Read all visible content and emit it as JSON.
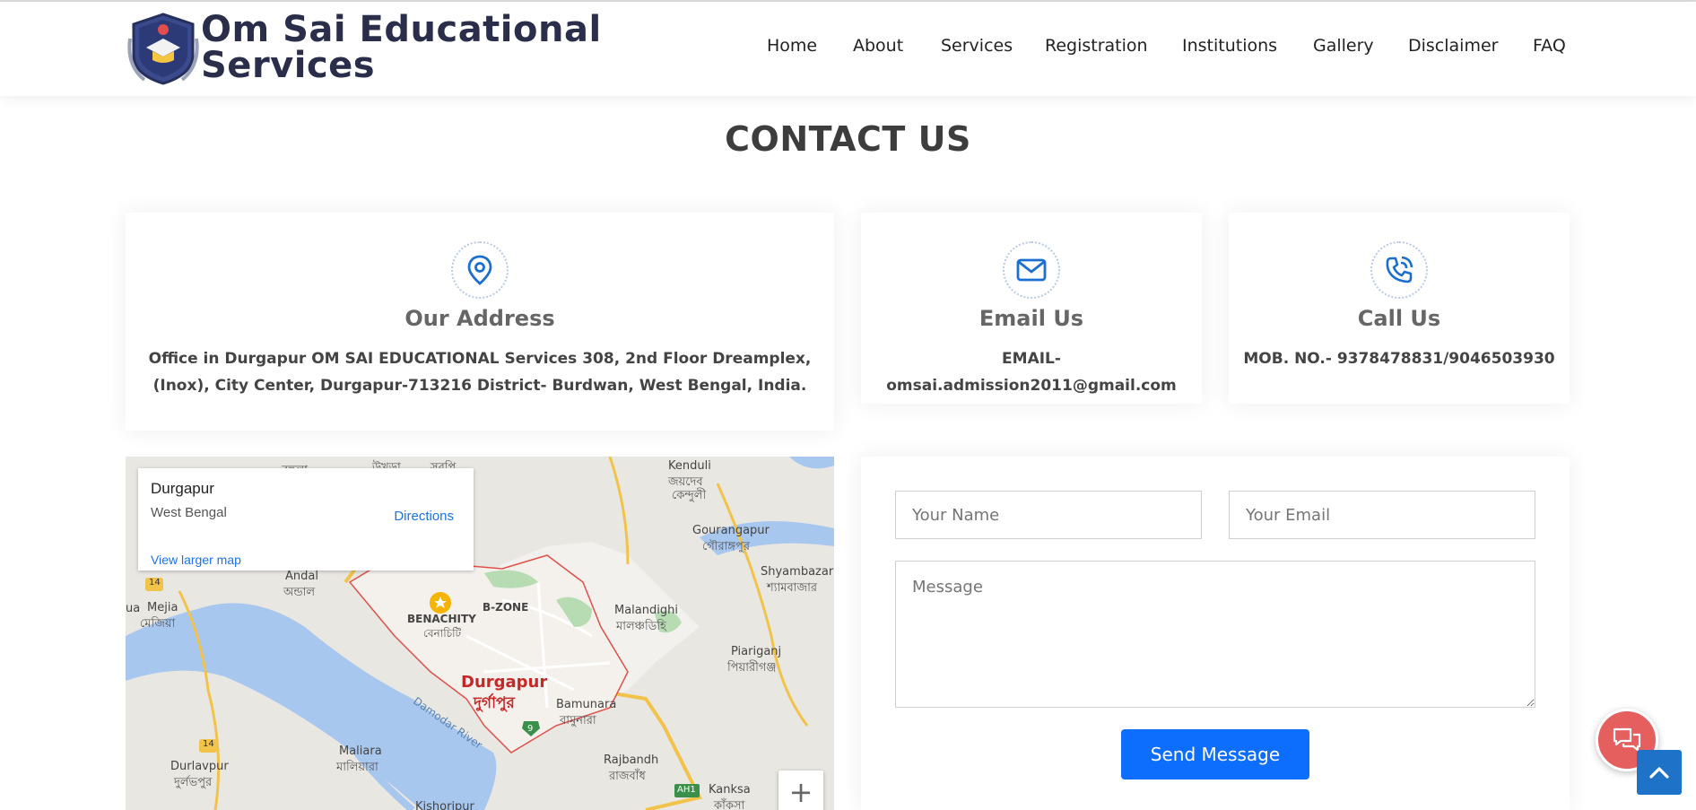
{
  "header": {
    "brand_line1": "Om Sai Educational",
    "brand_line2": "Services",
    "nav": [
      "Home",
      "About",
      "Services",
      "Registration",
      "Institutions",
      "Gallery",
      "Disclaimer",
      "FAQ"
    ]
  },
  "page": {
    "title": "CONTACT US"
  },
  "cards": {
    "address": {
      "icon": "map-pin-icon",
      "title": "Our Address",
      "text": "Office in Durgapur OM SAI EDUCATIONAL Services 308, 2nd Floor Dreamplex, (Inox), City Center, Durgapur-713216 District- Burdwan, West Bengal, India."
    },
    "email": {
      "icon": "envelope-icon",
      "title": "Email Us",
      "text": "EMAIL- omsai.admission2011@gmail.com"
    },
    "call": {
      "icon": "phone-call-icon",
      "title": "Call Us",
      "text": "MOB. NO.- 9378478831/9046503930"
    }
  },
  "map": {
    "popup_title": "Durgapur",
    "popup_subtitle": "West Bengal",
    "directions_label": "Directions",
    "larger_map_label": "View larger map",
    "zoom_in_label": "+",
    "labels": {
      "durgapur": "Durgapur",
      "durgapur_bn": "দুর্গাপুর",
      "benachity": "BENACHITY",
      "benachity_bn": "বেনাচিটি",
      "bzone": "B-ZONE",
      "andal": "Andal",
      "andal_bn": "অন্ডাল",
      "mejia": "Mejia",
      "mejia_bn": "মেজিয়া",
      "malandighi": "Malandighi",
      "malandighi_bn": "মালঞ্চডিহি",
      "gourangapur": "Gourangapur",
      "gourangapur_bn": "গৌরাঙ্গপুর",
      "shyambazar": "Shyambazar",
      "shyambazar_bn": "শ্যামবাজার",
      "kenduli": "Kenduli",
      "kenduli_bn1": "জয়দেব",
      "kenduli_bn2": "কেন্দুলী",
      "piariganj": "Piariganj",
      "piariganj_bn": "পিয়ারীগঞ্জ",
      "bamunara": "Bamunara",
      "bamunara_bn": "বামুনারা",
      "maliara": "Maliara",
      "maliara_bn": "মালিয়ারা",
      "durlavpur": "Durlavpur",
      "durlavpur_bn": "দুর্লভপুর",
      "rajbandh": "Rajbandh",
      "rajbandh_bn": "রাজবাঁধ",
      "kanksa": "Kanksa",
      "kanksa_bn": "কাঁকসা",
      "kishoripur": "Kishoripur",
      "damodar": "Damodar River",
      "ua": "ua",
      "road14a": "14",
      "road14b": "14",
      "road9": "9",
      "ah1": "AH1"
    }
  },
  "form": {
    "name_placeholder": "Your Name",
    "email_placeholder": "Your Email",
    "message_placeholder": "Message",
    "submit_label": "Send Message"
  },
  "floating": {
    "chat_icon": "chat-bubbles-icon",
    "top_icon": "chevron-up-icon"
  },
  "colors": {
    "primary": "#0d6efd",
    "icon_blue": "#1a6fd1",
    "chat_red": "#e55f5f",
    "back_to_top": "#1e73c8",
    "brand_navy": "#2b2e4a"
  }
}
